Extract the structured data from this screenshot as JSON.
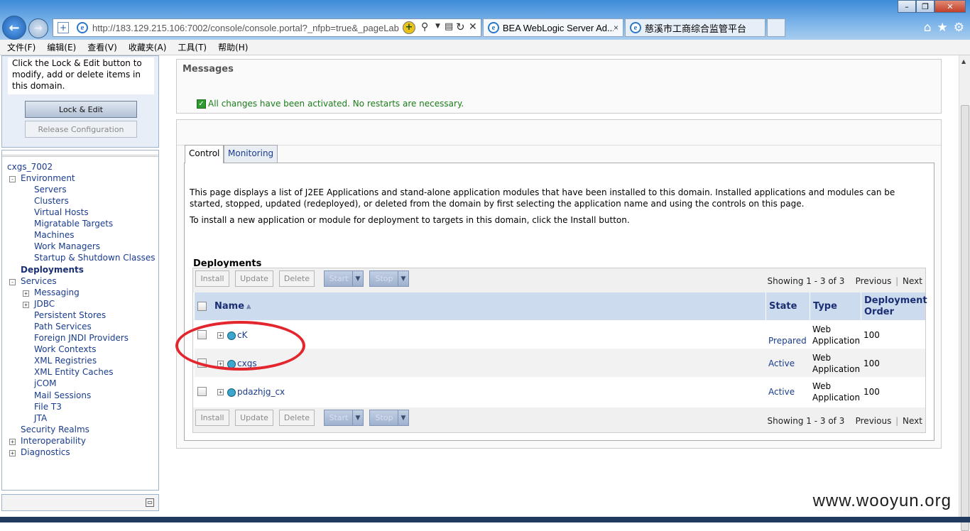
{
  "browser": {
    "url": "http://183.129.215.106:7002/console/console.portal?_nfpb=true&_pageLab",
    "tabs": [
      {
        "title": "BEA WebLogic Server Ad..."
      },
      {
        "title": "慈溪市工商综合监管平台"
      }
    ],
    "tab_close": "×",
    "window_controls": {
      "minimize": "–",
      "maximize": "❐",
      "close": "✕"
    },
    "icons": {
      "home": "⌂",
      "favorites": "★",
      "tools": "⚙"
    },
    "menu": [
      "文件(F)",
      "编辑(E)",
      "查看(V)",
      "收藏夹(A)",
      "工具(T)",
      "帮助(H)"
    ]
  },
  "change_center": {
    "text": "Click the Lock & Edit button to modify, add or delete items in this domain.",
    "lock_button": "Lock & Edit",
    "release_button": "Release Configuration"
  },
  "tree": {
    "root": "cxgs_7002",
    "environment": "Environment",
    "environment_children": [
      "Servers",
      "Clusters",
      "Virtual Hosts",
      "Migratable Targets",
      "Machines",
      "Work Managers",
      "Startup & Shutdown Classes"
    ],
    "deployments": "Deployments",
    "services": "Services",
    "services_children": [
      "Messaging",
      "JDBC",
      "Persistent Stores",
      "Path Services",
      "Foreign JNDI Providers",
      "Work Contexts",
      "XML Registries",
      "XML Entity Caches",
      "jCOM",
      "Mail Sessions",
      "File T3",
      "JTA"
    ],
    "security_realms": "Security Realms",
    "interoperability": "Interoperability",
    "diagnostics": "Diagnostics"
  },
  "messages": {
    "header": "Messages",
    "success": "All changes have been activated. No restarts are necessary."
  },
  "tabs": {
    "control": "Control",
    "monitoring": "Monitoring"
  },
  "description": {
    "para1": "This page displays a list of J2EE Applications and stand-alone application modules that have been installed to this domain. Installed applications and modules can be started, stopped, updated (redeployed), or deleted from the domain by first selecting the application name and using the controls on this page.",
    "para2": "To install a new application or module for deployment to targets in this domain, click the Install button."
  },
  "deployments": {
    "title": "Deployments",
    "buttons": {
      "install": "Install",
      "update": "Update",
      "delete": "Delete",
      "start": "Start",
      "stop": "Stop"
    },
    "paging": {
      "showing": "Showing 1 - 3 of 3",
      "previous": "Previous",
      "separator": "|",
      "next": "Next"
    },
    "columns": {
      "name": "Name",
      "sort_icon": "⩓",
      "state": "State",
      "type": "Type",
      "order": "Deployment Order"
    },
    "expand_glyph": "+",
    "rows": [
      {
        "name": "cK",
        "state": "Prepared",
        "type": "Web Application",
        "order": "100"
      },
      {
        "name": "cxgs",
        "state": "Active",
        "type": "Web Application",
        "order": "100"
      },
      {
        "name": "pdazhjg_cx",
        "state": "Active",
        "type": "Web Application",
        "order": "100"
      }
    ]
  },
  "watermark": "www.wooyun.org"
}
